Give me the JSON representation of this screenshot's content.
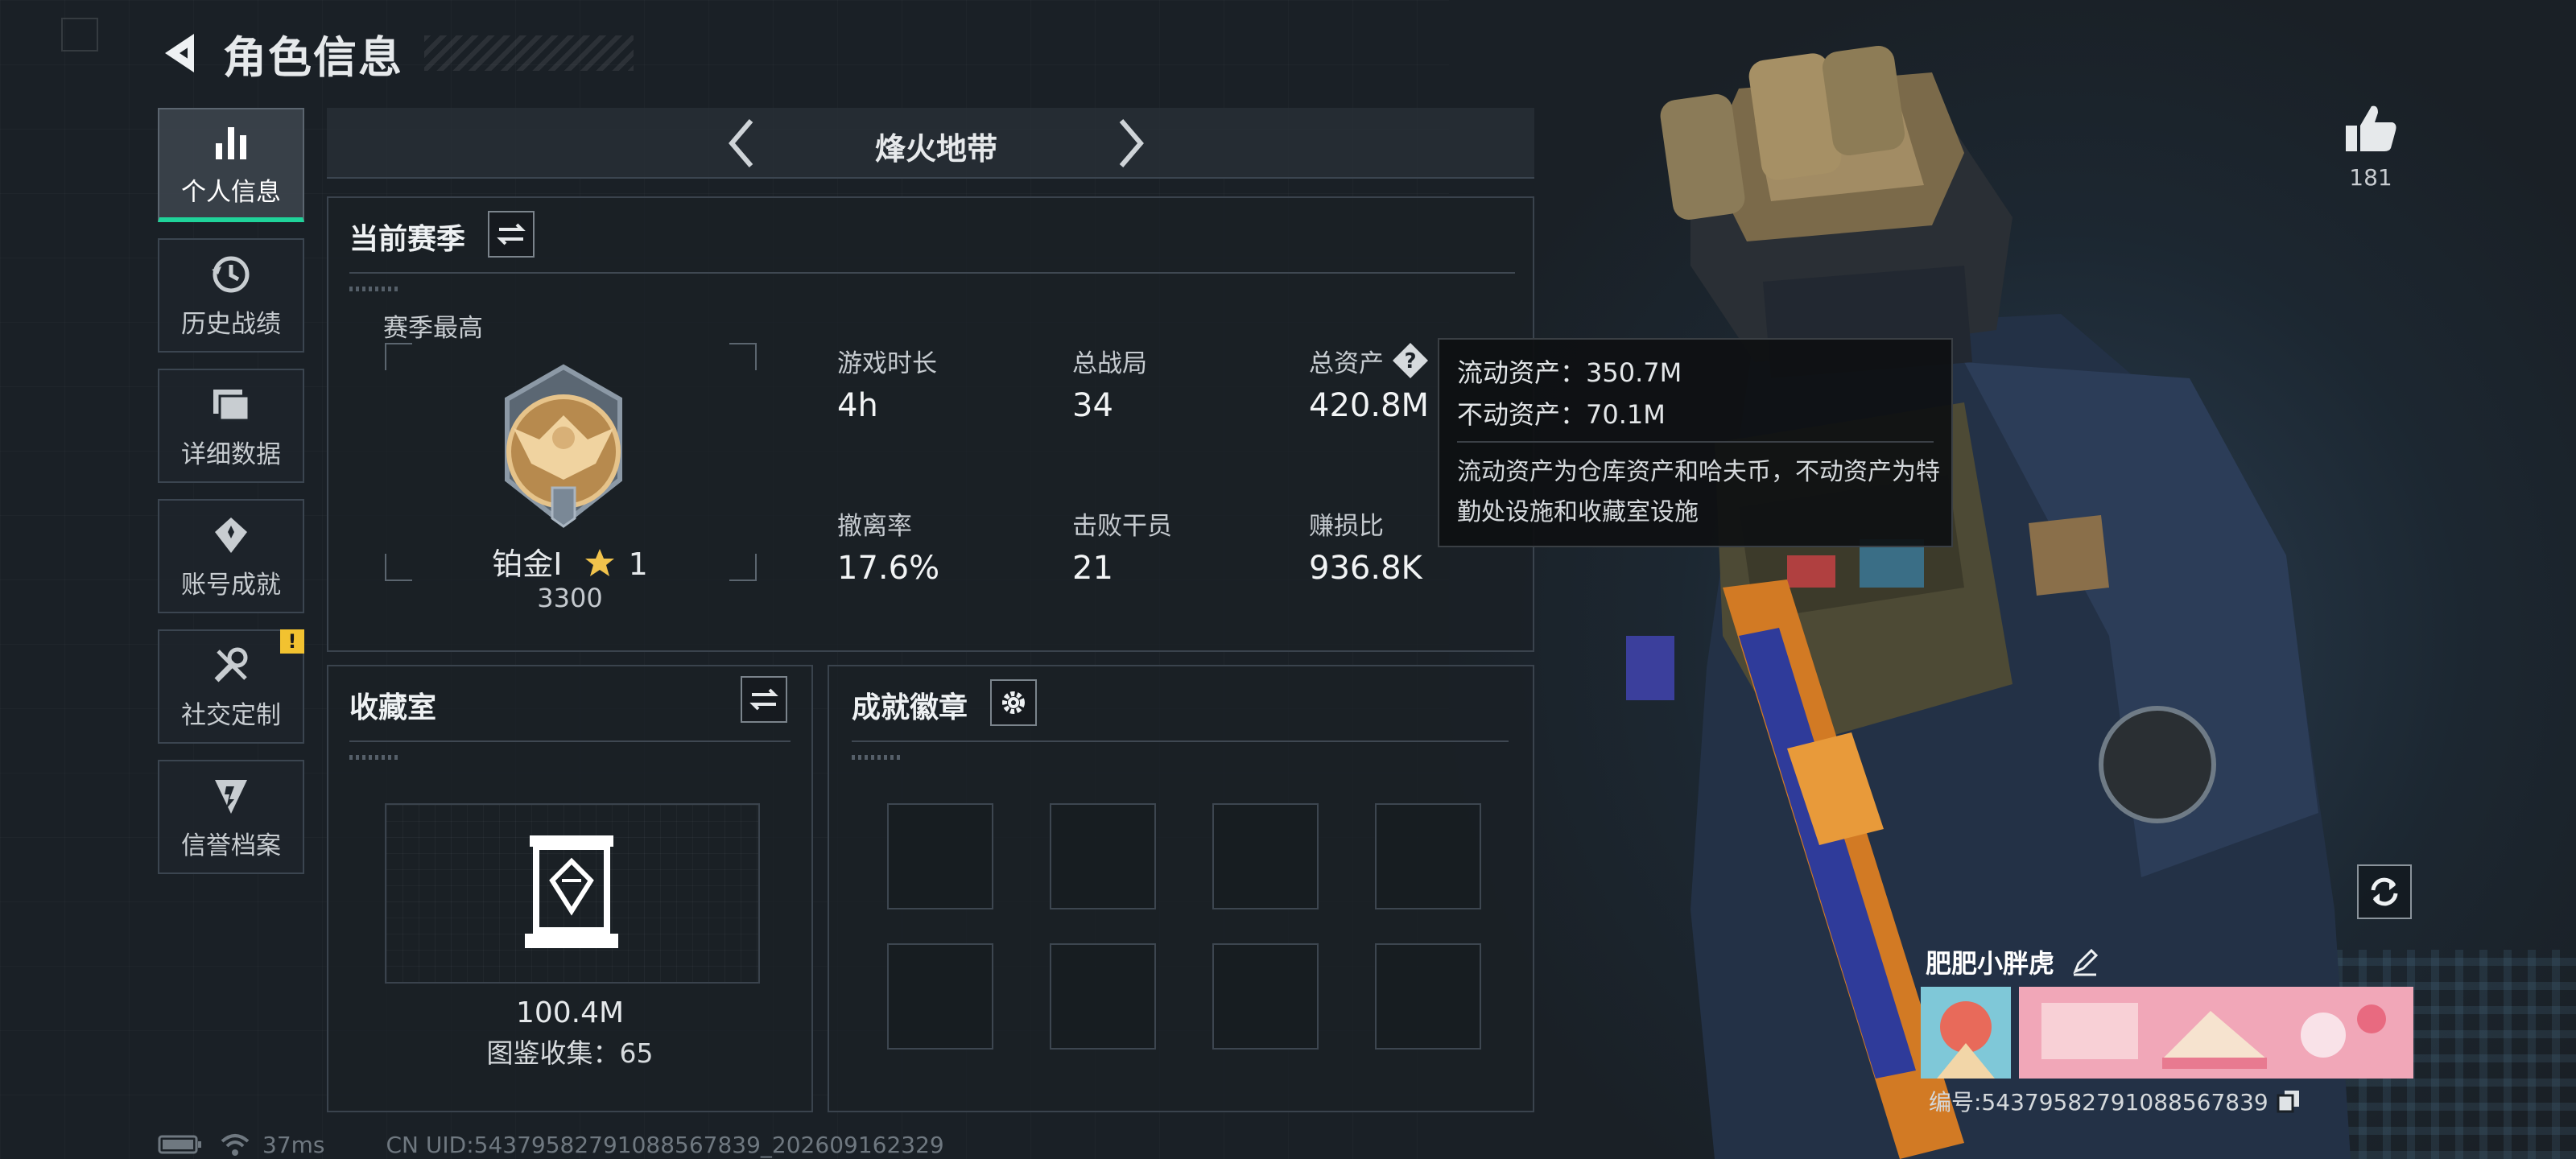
{
  "header": {
    "title": "角色信息"
  },
  "nav": {
    "items": [
      {
        "label": "个人信息",
        "icon": "bar-chart-icon",
        "active": true
      },
      {
        "label": "历史战绩",
        "icon": "history-icon"
      },
      {
        "label": "详细数据",
        "icon": "folder-icon"
      },
      {
        "label": "账号成就",
        "icon": "achievement-icon"
      },
      {
        "label": "社交定制",
        "icon": "tools-icon",
        "badge": "!"
      },
      {
        "label": "信誉档案",
        "icon": "reputation-icon"
      }
    ]
  },
  "mode": {
    "name": "烽火地带"
  },
  "season": {
    "title": "当前赛季",
    "best_label": "赛季最高",
    "rank_name": "铂金Ⅰ",
    "rank_stars": "1",
    "rank_score": "3300",
    "stats": [
      {
        "label": "游戏时长",
        "value": "4h"
      },
      {
        "label": "总战局",
        "value": "34"
      },
      {
        "label": "总资产",
        "value": "420.8M"
      },
      {
        "label": "撤离率",
        "value": "17.6%"
      },
      {
        "label": "击败干员",
        "value": "21"
      },
      {
        "label": "赚损比",
        "value": "936.8K"
      }
    ]
  },
  "tooltip": {
    "liquid": "流动资产：350.7M",
    "fixed": "不动资产：70.1M",
    "desc": "流动资产为仓库资产和哈夫币，不动资产为特勤处设施和收藏室设施"
  },
  "collection": {
    "title": "收藏室",
    "value": "100.4M",
    "count": "图鉴收集：65"
  },
  "achievements": {
    "title": "成就徽章",
    "slots": 8
  },
  "player": {
    "likes": "181",
    "name": "肥肥小胖虎",
    "id": "编号:543795827910885678​39"
  },
  "status": {
    "ping": "37ms",
    "uid": "CN UID:5437958279108856783​9_202609162329"
  },
  "colors": {
    "accent": "#1fd39a",
    "badge": "#f2c230"
  }
}
